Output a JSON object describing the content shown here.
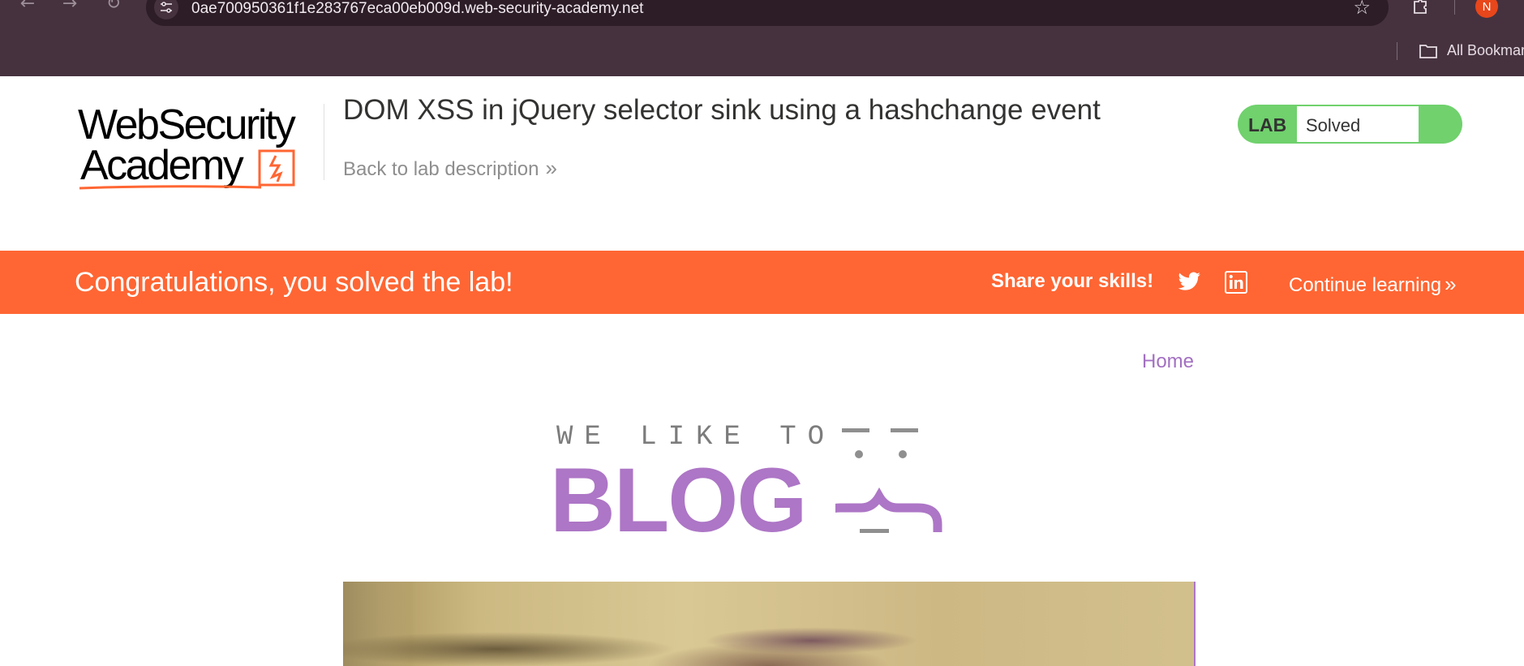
{
  "browser": {
    "url": "0ae700950361f1e283767eca00eb009d.web-security-academy.net",
    "bookmarks_label": "All Bookmarks",
    "profile_initial": "N"
  },
  "header": {
    "logo_line1": "WebSecurity",
    "logo_line2": "Academy",
    "lab_title": "DOM XSS in jQuery selector sink using a hashchange event",
    "back_link": "Back to lab description",
    "status_label": "LAB",
    "status_value": "Solved"
  },
  "banner": {
    "message": "Congratulations, you solved the lab!",
    "share_label": "Share your skills!",
    "continue_label": "Continue learning"
  },
  "blog": {
    "nav_home": "Home",
    "tagline": "WE LIKE TO",
    "word": "BLOG"
  },
  "colors": {
    "chrome_bg": "#46323f",
    "banner_orange": "#ff6633",
    "status_green": "#70d16d",
    "blog_purple": "#ad76c6"
  }
}
